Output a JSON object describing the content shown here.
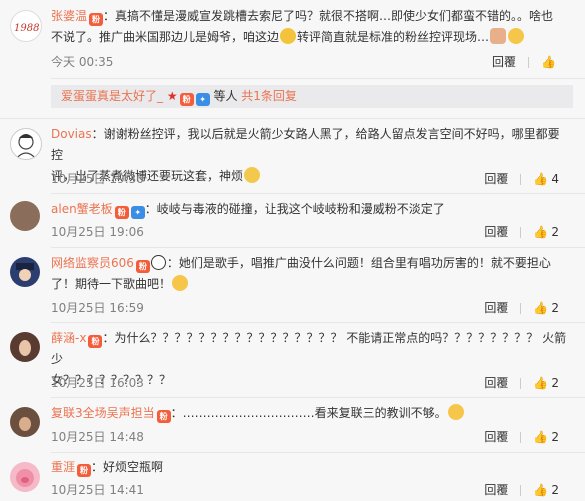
{
  "actions": {
    "reply": "回覆"
  },
  "comments": [
    {
      "name": "张婆温",
      "text1": "：真搞不懂是漫威宣发跳槽去索尼了吗？就很不搭啊…即使少女们都蛮不错的。。啥也",
      "text2": "不说了。推广曲米国那边儿是姆爷，咱这边",
      "text3": "转评简直就是标准的粉丝控评现场…",
      "time": "今天 00:35",
      "likes": ""
    },
    {
      "reply_name": "爱蛋蛋真是太好了_",
      "reply_suffix": "等人",
      "reply_count": "共1条回复"
    },
    {
      "name": "Dovias",
      "text1": "：谢谢粉丝控评，我以后就是火箭少女路人黑了，给路人留点发言空间不好吗，哪里都要控",
      "text2": "评，出了蒸煮微博还要玩这套，神烦",
      "time": "10月25日 19:30",
      "likes": "4"
    },
    {
      "name": "alen蟹老板",
      "text1": "：岐岐与毒液的碰撞，让我这个岐岐粉和漫威粉不淡定了",
      "time": "10月25日 19:06",
      "likes": "2"
    },
    {
      "name": "网络监察员606",
      "text1": "：她们是歌手，唱推广曲没什么问题！组合里有唱功厉害的！就不要担心",
      "text2": "了！期待一下歌曲吧！",
      "time": "10月25日 16:59",
      "likes": "2"
    },
    {
      "name": "薛涵-x",
      "text1": "：为什么？？？？？？？？？？？？？？？？   不能请正常点的吗？？？？？？？？  火箭少",
      "text2": "女？？？？？？？？？",
      "time": "10月25日 16:03",
      "likes": "2"
    },
    {
      "name": "复联3全场吴声担当",
      "text1": "：……………………………看来复联三的教训不够。",
      "time": "10月25日 14:48",
      "likes": "2"
    },
    {
      "name": "重涯",
      "text1": "：好烦空瓶啊",
      "time": "10月25日 14:41",
      "likes": "2"
    }
  ]
}
